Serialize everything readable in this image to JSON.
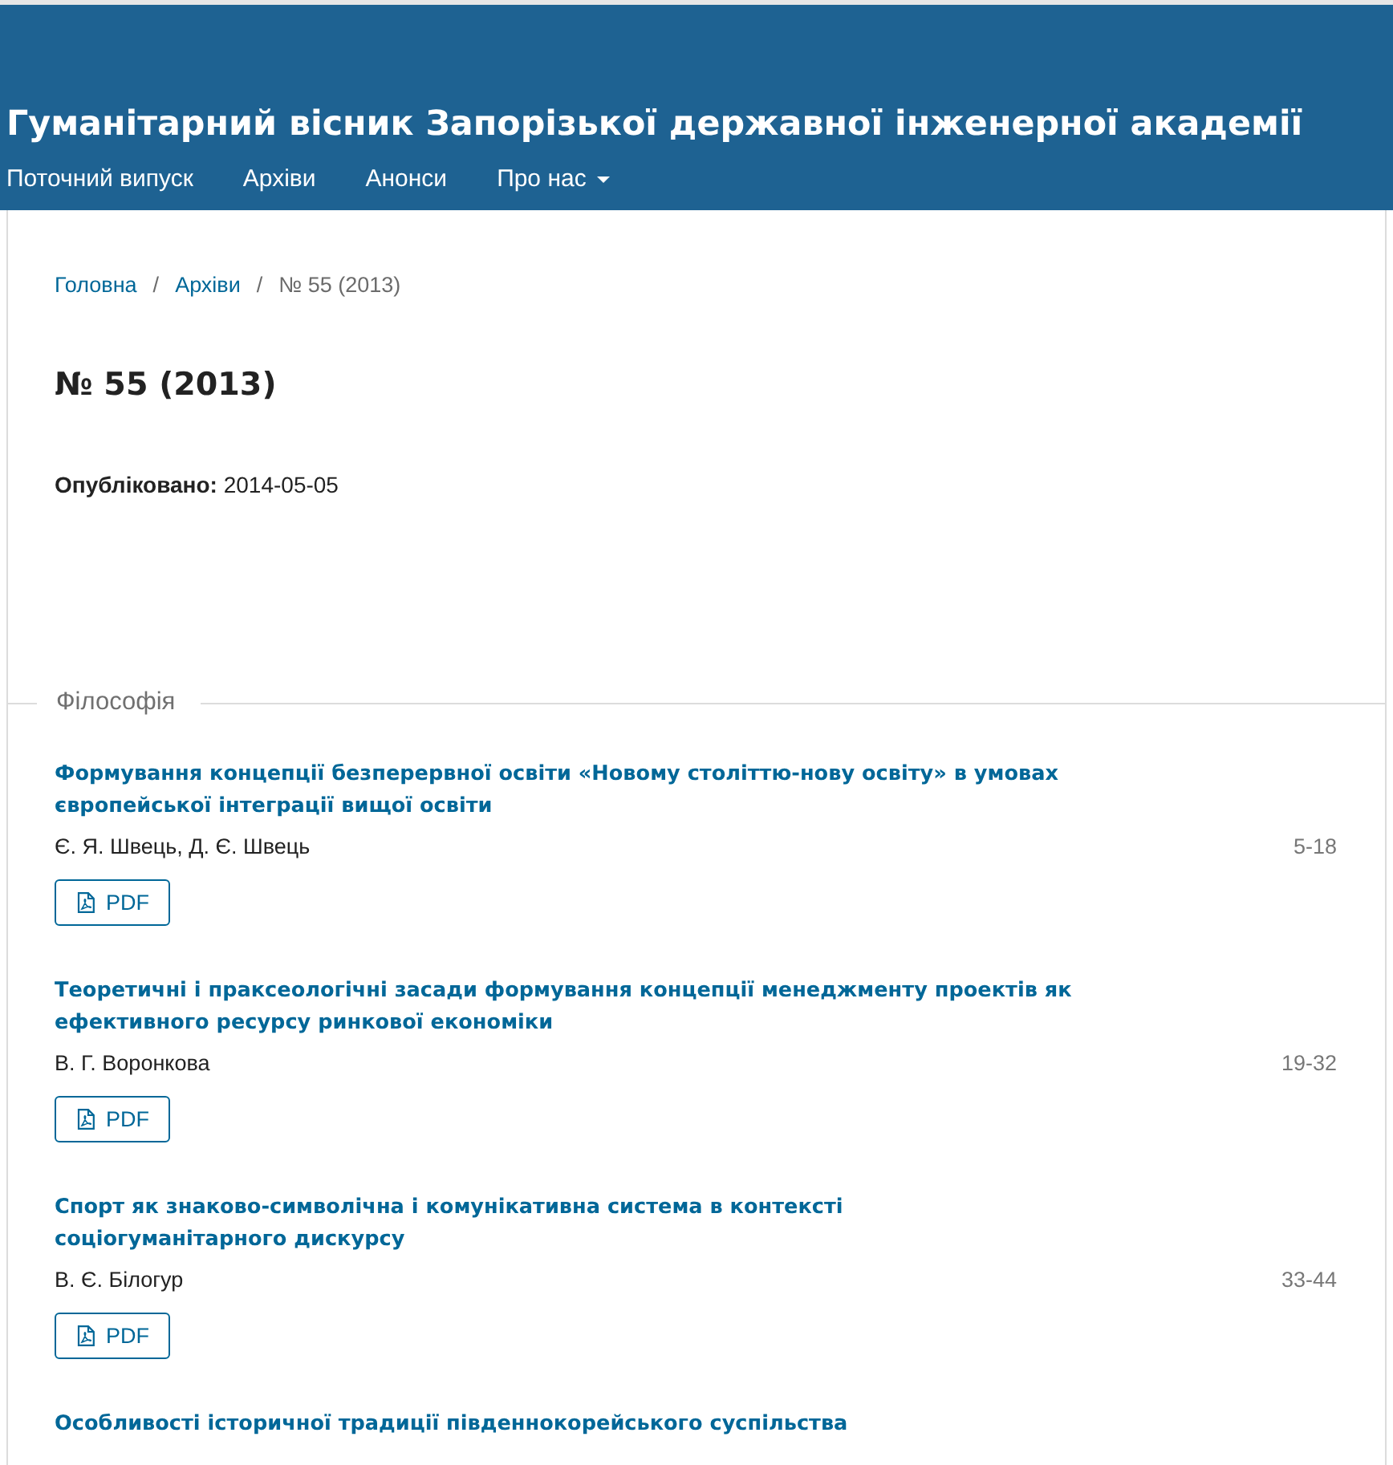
{
  "header": {
    "title": "Гуманітарний вісник Запорізької державної інженерної академії",
    "nav": [
      {
        "label": "Поточний випуск",
        "dropdown": false
      },
      {
        "label": "Архіви",
        "dropdown": false
      },
      {
        "label": "Анонси",
        "dropdown": false
      },
      {
        "label": "Про нас",
        "dropdown": true
      }
    ]
  },
  "breadcrumbs": {
    "separator": "/",
    "items": [
      {
        "label": "Головна",
        "current": false
      },
      {
        "label": "Архіви",
        "current": false
      },
      {
        "label": "№ 55 (2013)",
        "current": true
      }
    ]
  },
  "issue": {
    "title": "№ 55 (2013)",
    "published": "**Опубліковано:** 2014-05-05"
  },
  "sections": [
    {
      "title": "Філософія",
      "articles": [
        {
          "title": "Формування концепції безперервної освіти «Новому століттю-нову освіту» в умовах європейської інтеграції вищої освіти",
          "authors": "Є. Я. Швець, Д. Є. Швець",
          "pages": "5-18",
          "galleys": [
            {
              "label": "PDF",
              "kind": "pdf"
            }
          ]
        },
        {
          "title": "Теоретичні і праксеологічні засади формування концепції менеджменту проектів як ефективного ресурсу ринкової економіки",
          "authors": "В. Г. Воронкова",
          "pages": "19-32",
          "galleys": [
            {
              "label": "PDF",
              "kind": "pdf"
            }
          ]
        },
        {
          "title": "Спорт як знаково-символічна і комунікативна система в контексті соціогуманітарного дискурсу",
          "authors": "В. Є. Білогур",
          "pages": "33-44",
          "galleys": [
            {
              "label": "PDF",
              "kind": "pdf"
            }
          ]
        },
        {
          "title": "Особливості історичної традиції південнокорейського суспільства"
        }
      ]
    }
  ]
}
